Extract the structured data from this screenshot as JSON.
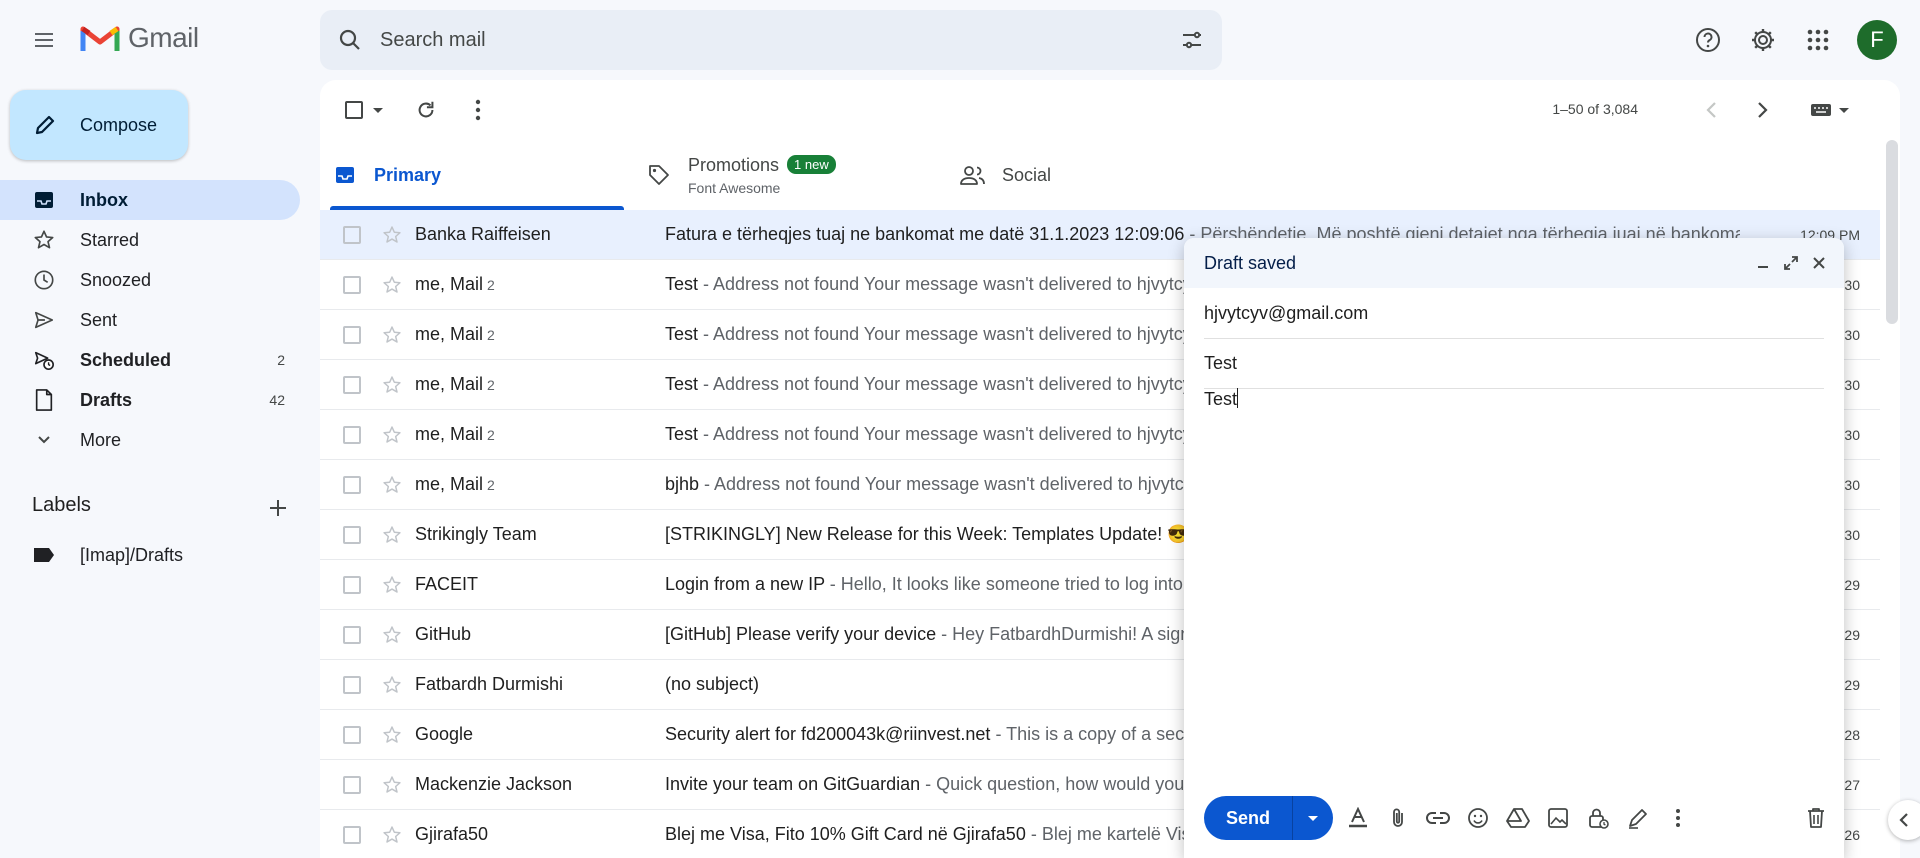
{
  "header": {
    "app_name": "Gmail",
    "search_placeholder": "Search mail",
    "avatar_letter": "F"
  },
  "sidebar": {
    "compose_label": "Compose",
    "items": [
      {
        "label": "Inbox",
        "count": "",
        "icon": "inbox-icon",
        "active": true
      },
      {
        "label": "Starred",
        "count": "",
        "icon": "star-icon"
      },
      {
        "label": "Snoozed",
        "count": "",
        "icon": "clock-icon"
      },
      {
        "label": "Sent",
        "count": "",
        "icon": "send-icon"
      },
      {
        "label": "Scheduled",
        "count": "2",
        "icon": "schedule-send-icon",
        "bold": true
      },
      {
        "label": "Drafts",
        "count": "42",
        "icon": "draft-icon",
        "bold": true
      },
      {
        "label": "More",
        "count": "",
        "icon": "chevron-down-icon"
      }
    ],
    "labels_title": "Labels",
    "labels": [
      {
        "label": "[Imap]/Drafts",
        "icon": "label-icon"
      }
    ]
  },
  "toolbar": {
    "pager": "1–50 of 3,084"
  },
  "tabs": [
    {
      "label": "Primary",
      "icon": "inbox-icon",
      "active": true
    },
    {
      "label": "Promotions",
      "badge": "1 new",
      "sub": "Font Awesome",
      "icon": "tag-icon"
    },
    {
      "label": "Social",
      "icon": "people-icon"
    }
  ],
  "emails": [
    {
      "sender": "Banka Raiffeisen",
      "count": "",
      "subject": "Fatura e tërheqjes tuaj ne bankomat me datë 31.1.2023 12:09:06",
      "snippet": " - Përshëndetje, Më poshtë gjeni detajet nga tërheqja juaj në bankoma",
      "time": "12:09 PM"
    },
    {
      "sender": "me, Mail",
      "count": "2",
      "subject": "Test",
      "snippet": " - Address not found Your message wasn't delivered to hjvytcyv@gmail.com",
      "time": "30"
    },
    {
      "sender": "me, Mail",
      "count": "2",
      "subject": "Test",
      "snippet": " - Address not found Your message wasn't delivered to hjvytcyv@gmail.com",
      "time": "30"
    },
    {
      "sender": "me, Mail",
      "count": "2",
      "subject": "Test",
      "snippet": " - Address not found Your message wasn't delivered to hjvytcyv@gmail.com",
      "time": "30"
    },
    {
      "sender": "me, Mail",
      "count": "2",
      "subject": "Test",
      "snippet": " - Address not found Your message wasn't delivered to hjvytcyv@gmail.com",
      "time": "30"
    },
    {
      "sender": "me, Mail",
      "count": "2",
      "subject": "bjhb",
      "snippet": " - Address not found Your message wasn't delivered to hjvytcyv@gmail.com",
      "time": "30"
    },
    {
      "sender": "Strikingly Team",
      "count": "",
      "subject": "[STRIKINGLY] New Release for this Week: Templates Update! 😎",
      "snippet": " - ",
      "time": "30"
    },
    {
      "sender": "FACEIT",
      "count": "",
      "subject": "Login from a new IP",
      "snippet": " - Hello, It looks like someone tried to log into your account",
      "time": "29"
    },
    {
      "sender": "GitHub",
      "count": "",
      "subject": "[GitHub] Please verify your device",
      "snippet": " - Hey FatbardhDurmishi! A sign in attempt requires further verification",
      "time": "29"
    },
    {
      "sender": "Fatbardh Durmishi",
      "count": "",
      "subject": "(no subject)",
      "snippet": "",
      "time": "29"
    },
    {
      "sender": "Google",
      "count": "",
      "subject": "Security alert for fd200043k@riinvest.net",
      "snippet": " - This is a copy of a security alert sent to",
      "time": "28"
    },
    {
      "sender": "Mackenzie Jackson",
      "count": "",
      "subject": "Invite your team on GitGuardian",
      "snippet": " - Quick question, how would you like to",
      "time": "27"
    },
    {
      "sender": "Gjirafa50",
      "count": "",
      "subject": "Blej me Visa, Fito 10% Gift Card në Gjirafa50",
      "snippet": " - Blej me kartelë Visa dhe fito",
      "time": "26"
    }
  ],
  "compose_window": {
    "title": "Draft saved",
    "to": "hjvytcyv@gmail.com",
    "subject": "Test",
    "body": "Test",
    "send_label": "Send"
  },
  "colors": {
    "accent": "#0b57d0",
    "compose_bg": "#c2e7ff",
    "active_nav": "#d3e3fd",
    "badge": "#188038",
    "avatar": "#1e6c2b"
  }
}
